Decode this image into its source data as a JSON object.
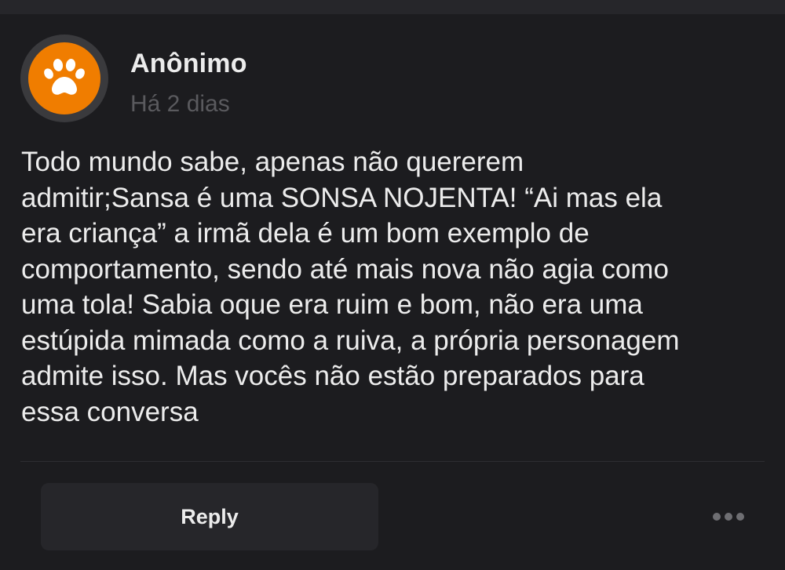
{
  "comment": {
    "author": "Anônimo",
    "timestamp": "Há 2 dias",
    "avatar_icon": "paw-icon",
    "avatar_color": "#f07d00",
    "body_lines": [
      "Todo mundo sabe, apenas não quererem",
      "admitir;Sansa é uma SONSA NOJENTA! “Ai mas ela",
      "era criança” a irmã dela é um bom exemplo de",
      "comportamento, sendo até mais nova não agia como",
      "uma tola! Sabia oque era ruim e bom, não era uma",
      "estúpida mimada como a ruiva, a própria personagem",
      "admite isso. Mas vocês não estão preparados para",
      "essa conversa"
    ]
  },
  "actions": {
    "reply_label": "Reply",
    "more_icon": "more-horizontal-icon"
  },
  "colors": {
    "background": "#1c1c1f",
    "button_background": "#26262a",
    "text": "#ececec",
    "muted_text": "#5a5a5e"
  }
}
